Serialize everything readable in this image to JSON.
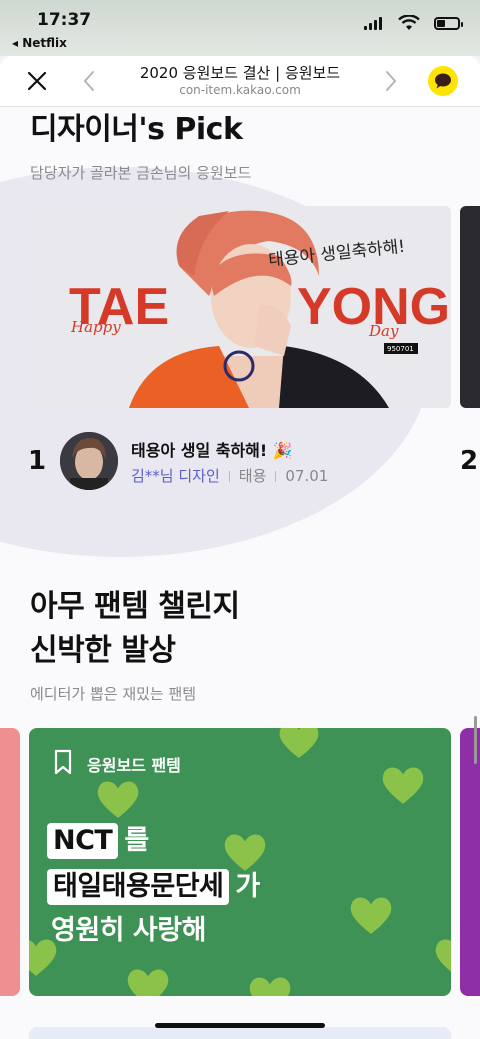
{
  "status_bar": {
    "time": "17:37",
    "back_app": "◂ Netflix"
  },
  "header": {
    "title": "2020 응원보드 결산 | 응원보드",
    "url": "con-item.kakao.com"
  },
  "designers_pick": {
    "title": "디자이너's Pick",
    "subtitle": "담당자가 골라본 금손님의 응원보드",
    "banner": {
      "script_text": "태용아 생일축하해!",
      "big_left": "TAE",
      "big_right": "YONG",
      "happy": "Happy",
      "day": "Day",
      "date_tag": "950701"
    },
    "item": {
      "rank": "1",
      "next_rank": "2",
      "title": "태용아 생일 축하해! 🎉",
      "designer": "김**님 디자인",
      "artist": "태용",
      "date": "07.01"
    }
  },
  "fantem": {
    "title_line1": "아무 팬템 챌린지",
    "title_line2": "신박한 발상",
    "subtitle": "에디터가 뽑은 재밌는 팬템",
    "card": {
      "label": "응원보드 팬템",
      "chip1": "NCT",
      "after1": "를",
      "chip2": "태일태용문단세",
      "after2": "가",
      "line3": "영원히 사랑해"
    },
    "colors": {
      "card_bg": "#3e9256",
      "left_card": "#ee8f91",
      "right_card": "#8e2fa8"
    }
  },
  "colors": {
    "kakao_yellow": "#fee500",
    "designer_link": "#5b5ec7"
  }
}
